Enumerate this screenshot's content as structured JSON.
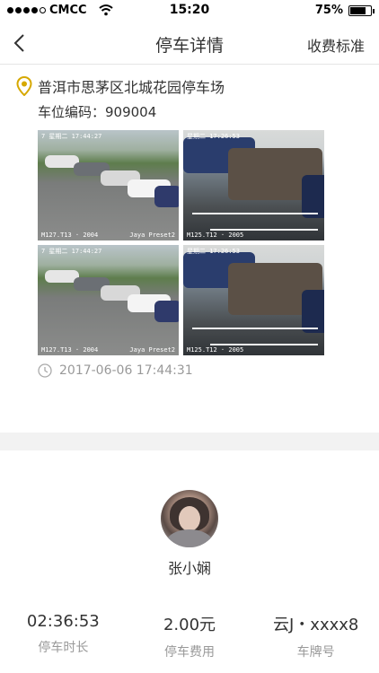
{
  "status_bar": {
    "carrier": "CMCC",
    "time": "15:20",
    "battery": "75%",
    "battery_level": 0.75,
    "signal_bars": 4
  },
  "nav": {
    "title": "停车详情",
    "action": "收费标准",
    "back_icon": "chevron-left-icon"
  },
  "parking": {
    "location": "普洱市思茅区北城花园停车场",
    "space_code": "车位编码：909004",
    "timestamp": "2017-06-06 17:44:31",
    "photos": [
      {
        "stamp_top": "7 星期二 17:44:27",
        "left_label": "M127.T13 · 2004",
        "right_label": "Jaya Preset2",
        "kind": "a"
      },
      {
        "stamp_top": "星期二 17:26:53",
        "left_label": "M125.T12 · 2005",
        "right_label": "",
        "kind": "b"
      },
      {
        "stamp_top": "7 星期二 17:44:27",
        "left_label": "M127.T13 · 2004",
        "right_label": "Jaya Preset2",
        "kind": "a"
      },
      {
        "stamp_top": "星期二 17:26:53",
        "left_label": "M125.T12 · 2005",
        "right_label": "",
        "kind": "b"
      }
    ]
  },
  "user": {
    "name": "张小娴"
  },
  "stats": [
    {
      "value": "02:36:53",
      "label": "停车时长"
    },
    {
      "value": "2.00元",
      "label": "停车费用"
    },
    {
      "value": "云J・xxxx8",
      "label": "车牌号"
    }
  ],
  "colors": {
    "pin": "#e0b400",
    "muted": "#999999",
    "divider": "#f2f2f2"
  }
}
